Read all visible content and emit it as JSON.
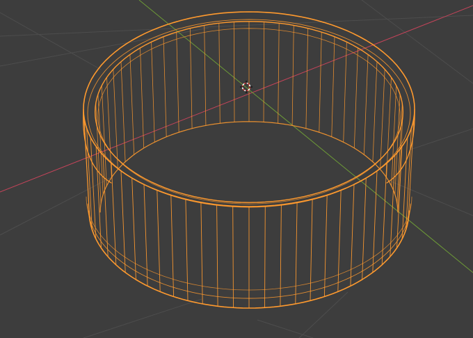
{
  "viewport": {
    "mode": "wireframe",
    "background_color": "#3d3d3d",
    "grid_color": "#4d4d4d",
    "grid_visible": true
  },
  "axes": {
    "x_axis_color": "#c6445a",
    "y_axis_color": "#6d9b37"
  },
  "object": {
    "type": "ring",
    "selected": true,
    "wire_color": "#ff9a2e",
    "vertical_edge_count": 64
  },
  "cursor_3d": {
    "icon": "3d-cursor-icon",
    "colors": [
      "#ffffff",
      "#d83c3c"
    ]
  }
}
